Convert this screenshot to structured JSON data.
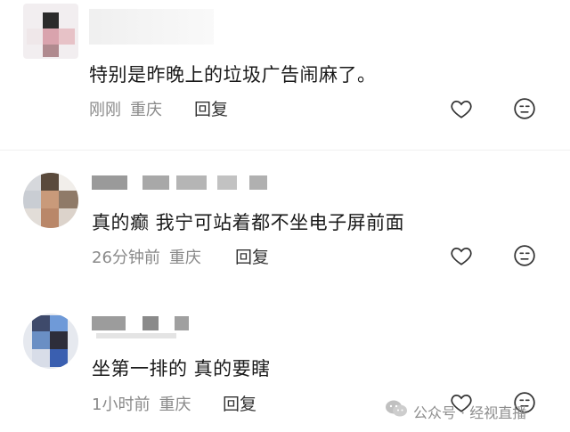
{
  "comments": [
    {
      "text": "特别是昨晚上的垃圾广告闹麻了。",
      "time": "刚刚",
      "location": "重庆",
      "reply_label": "回复"
    },
    {
      "text": "真的癫  我宁可站着都不坐电子屏前面",
      "time": "26分钟前",
      "location": "重庆",
      "reply_label": "回复"
    },
    {
      "text": "坐第一排的 真的要瞎",
      "time": "1小时前",
      "location": "重庆",
      "reply_label": "回复"
    }
  ],
  "icons": {
    "like": "heart-outline-icon",
    "react": "neutral-face-icon"
  },
  "watermark": {
    "text": "公众号 · 经视直播"
  },
  "colors": {
    "text": "#1a1a1a",
    "meta": "#8a8a8a",
    "icon": "#333333"
  }
}
